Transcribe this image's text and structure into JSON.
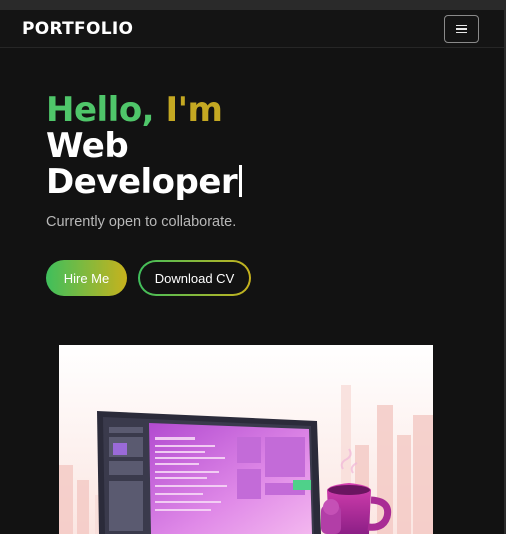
{
  "navbar": {
    "brand": "PORTFOLIO",
    "menu_icon": "hamburger-menu-icon"
  },
  "hero": {
    "greeting_part1": "Hello,",
    "greeting_part2": "I'm",
    "role_line1": "Web",
    "role_line2": "Developer",
    "tagline": "Currently open to collaborate.",
    "hire_button": "Hire Me",
    "cv_button": "Download CV",
    "image_alt": "developer-illustration"
  },
  "colors": {
    "background": "#121212",
    "accent_green": "#4fc66a",
    "accent_gold": "#c4a822",
    "text_muted": "#b8b8b8"
  }
}
